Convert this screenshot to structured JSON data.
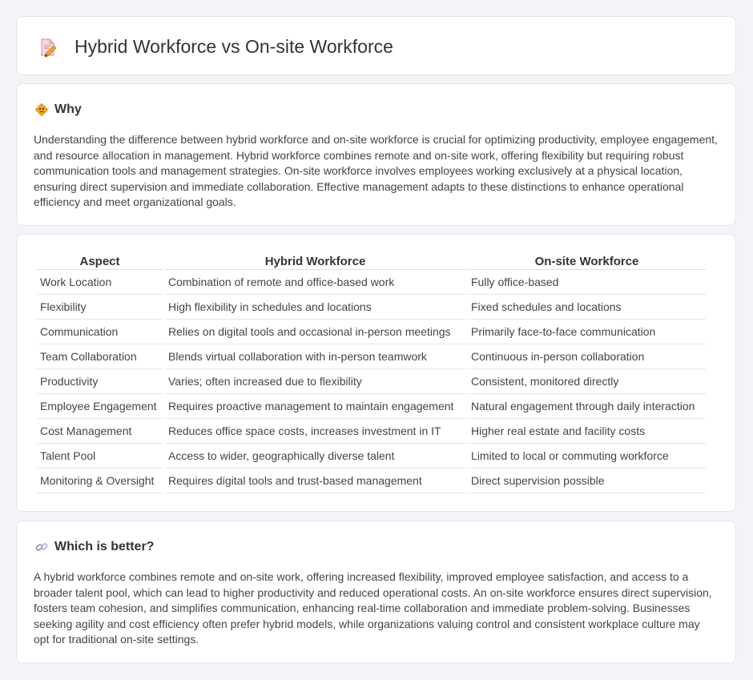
{
  "title": "Hybrid Workforce vs On-site Workforce",
  "why": {
    "heading": "Why",
    "text": "Understanding the difference between hybrid workforce and on-site workforce is crucial for optimizing productivity, employee engagement, and resource allocation in management. Hybrid workforce combines remote and on-site work, offering flexibility but requiring robust communication tools and management strategies. On-site workforce involves employees working exclusively at a physical location, ensuring direct supervision and immediate collaboration. Effective management adapts to these distinctions to enhance operational efficiency and meet organizational goals."
  },
  "table": {
    "headers": [
      "Aspect",
      "Hybrid Workforce",
      "On-site Workforce"
    ],
    "rows": [
      [
        "Work Location",
        "Combination of remote and office-based work",
        "Fully office-based"
      ],
      [
        "Flexibility",
        "High flexibility in schedules and locations",
        "Fixed schedules and locations"
      ],
      [
        "Communication",
        "Relies on digital tools and occasional in-person meetings",
        "Primarily face-to-face communication"
      ],
      [
        "Team Collaboration",
        "Blends virtual collaboration with in-person teamwork",
        "Continuous in-person collaboration"
      ],
      [
        "Productivity",
        "Varies; often increased due to flexibility",
        "Consistent, monitored directly"
      ],
      [
        "Employee Engagement",
        "Requires proactive management to maintain engagement",
        "Natural engagement through daily interaction"
      ],
      [
        "Cost Management",
        "Reduces office space costs, increases investment in IT",
        "Higher real estate and facility costs"
      ],
      [
        "Talent Pool",
        "Access to wider, geographically diverse talent",
        "Limited to local or commuting workforce"
      ],
      [
        "Monitoring & Oversight",
        "Requires digital tools and trust-based management",
        "Direct supervision possible"
      ]
    ]
  },
  "better": {
    "heading": "Which is better?",
    "text": "A hybrid workforce combines remote and on-site work, offering increased flexibility, improved employee satisfaction, and access to a broader talent pool, which can lead to higher productivity and reduced operational costs. An on-site workforce ensures direct supervision, fosters team cohesion, and simplifies communication, enhancing real-time collaboration and immediate problem-solving. Businesses seeking agility and cost efficiency often prefer hybrid models, while organizations valuing control and consistent workplace culture may opt for traditional on-site settings."
  },
  "icons": {
    "title": "document-pencil-icon",
    "why": "warning-sign-icon",
    "better": "link-icon"
  }
}
